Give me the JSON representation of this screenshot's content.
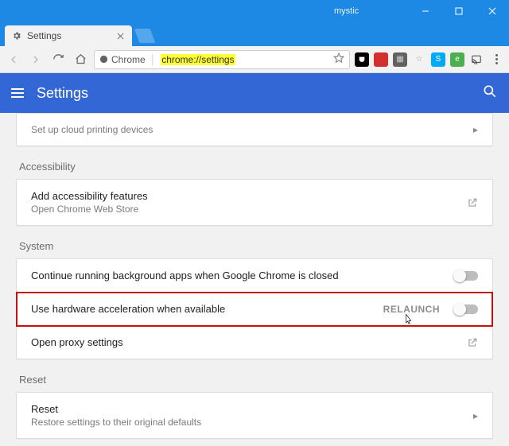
{
  "window": {
    "user": "mystic"
  },
  "tab": {
    "title": "Settings"
  },
  "omnibox": {
    "origin_label": "Chrome",
    "url_prefix": "chrome://",
    "url_path": "settings"
  },
  "header": {
    "title": "Settings"
  },
  "cards": {
    "cloud_print": {
      "title": "Set up cloud printing devices"
    },
    "accessibility_label": "Accessibility",
    "accessibility": {
      "title": "Add accessibility features",
      "sub": "Open Chrome Web Store"
    },
    "system_label": "System",
    "system": {
      "bg_apps": "Continue running background apps when Google Chrome is closed",
      "hw_accel": "Use hardware acceleration when available",
      "relaunch": "RELAUNCH",
      "proxy": "Open proxy settings"
    },
    "reset_label": "Reset",
    "reset": {
      "title": "Reset",
      "sub": "Restore settings to their original defaults"
    }
  }
}
